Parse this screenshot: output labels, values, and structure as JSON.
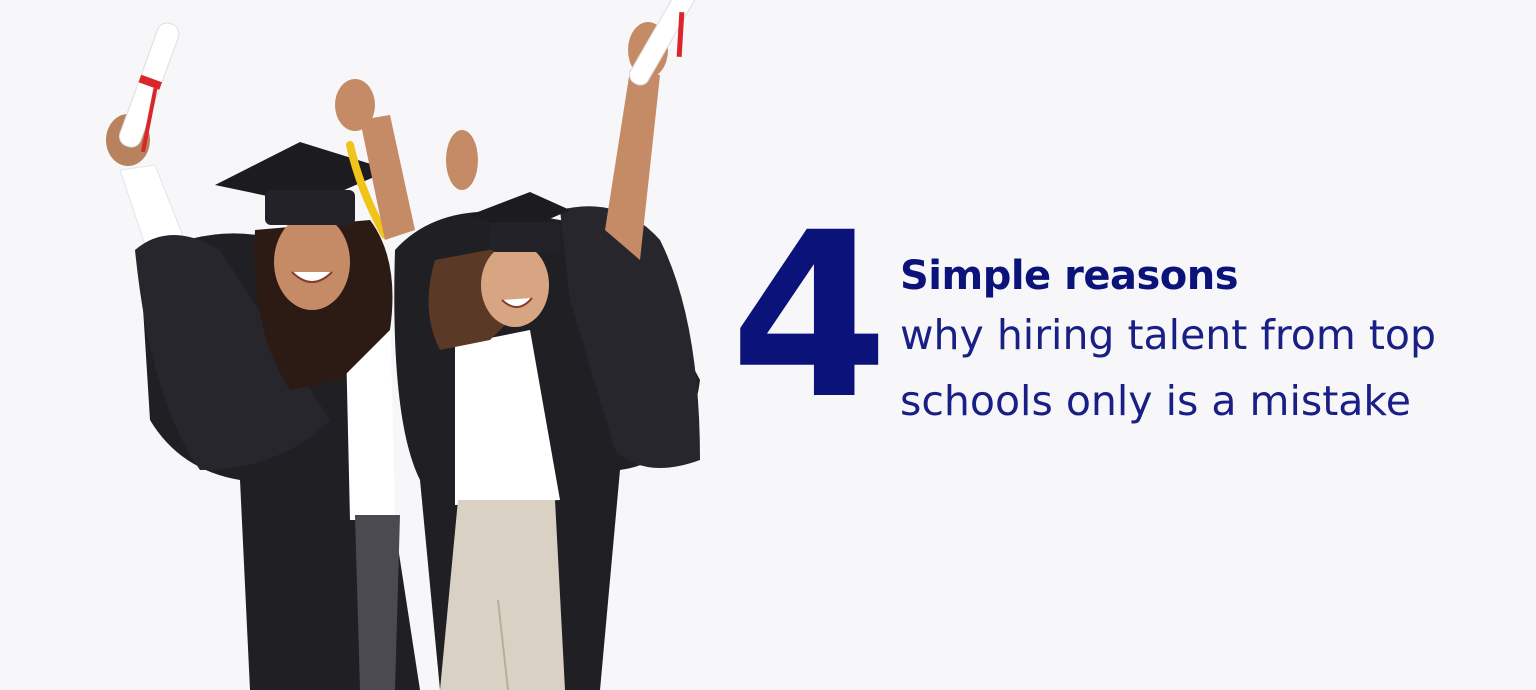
{
  "headline": {
    "number": "4",
    "title": "Simple reasons",
    "subtitle_lines": [
      "why hiring talent from top",
      "schools only is a mistake"
    ]
  },
  "colors": {
    "background": "#f7f7f9",
    "accent_navy": "#0b137a",
    "gown_black": "#1f1f24",
    "tassel_yellow": "#f0c419",
    "ribbon_red": "#d9262b"
  },
  "image": {
    "subject": "graduates-celebrating-photo"
  }
}
